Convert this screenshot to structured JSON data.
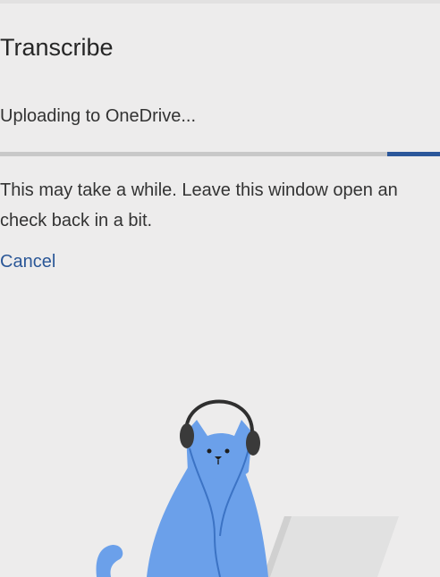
{
  "pane": {
    "title": "Transcribe",
    "status": "Uploading to OneDrive...",
    "message_line1": "This may take a while. Leave this window open an",
    "message_line2": "check back in a bit.",
    "cancel_label": "Cancel"
  },
  "progress": {
    "fraction": 0.12
  },
  "illustration": {
    "icon": "cat-with-headphones-illustration",
    "subject": "cat",
    "accessories": [
      "headphones",
      "laptop"
    ]
  },
  "colors": {
    "background": "#edecec",
    "accent": "#2b579a",
    "link": "#2b5797",
    "cat": "#6ba0ea"
  }
}
